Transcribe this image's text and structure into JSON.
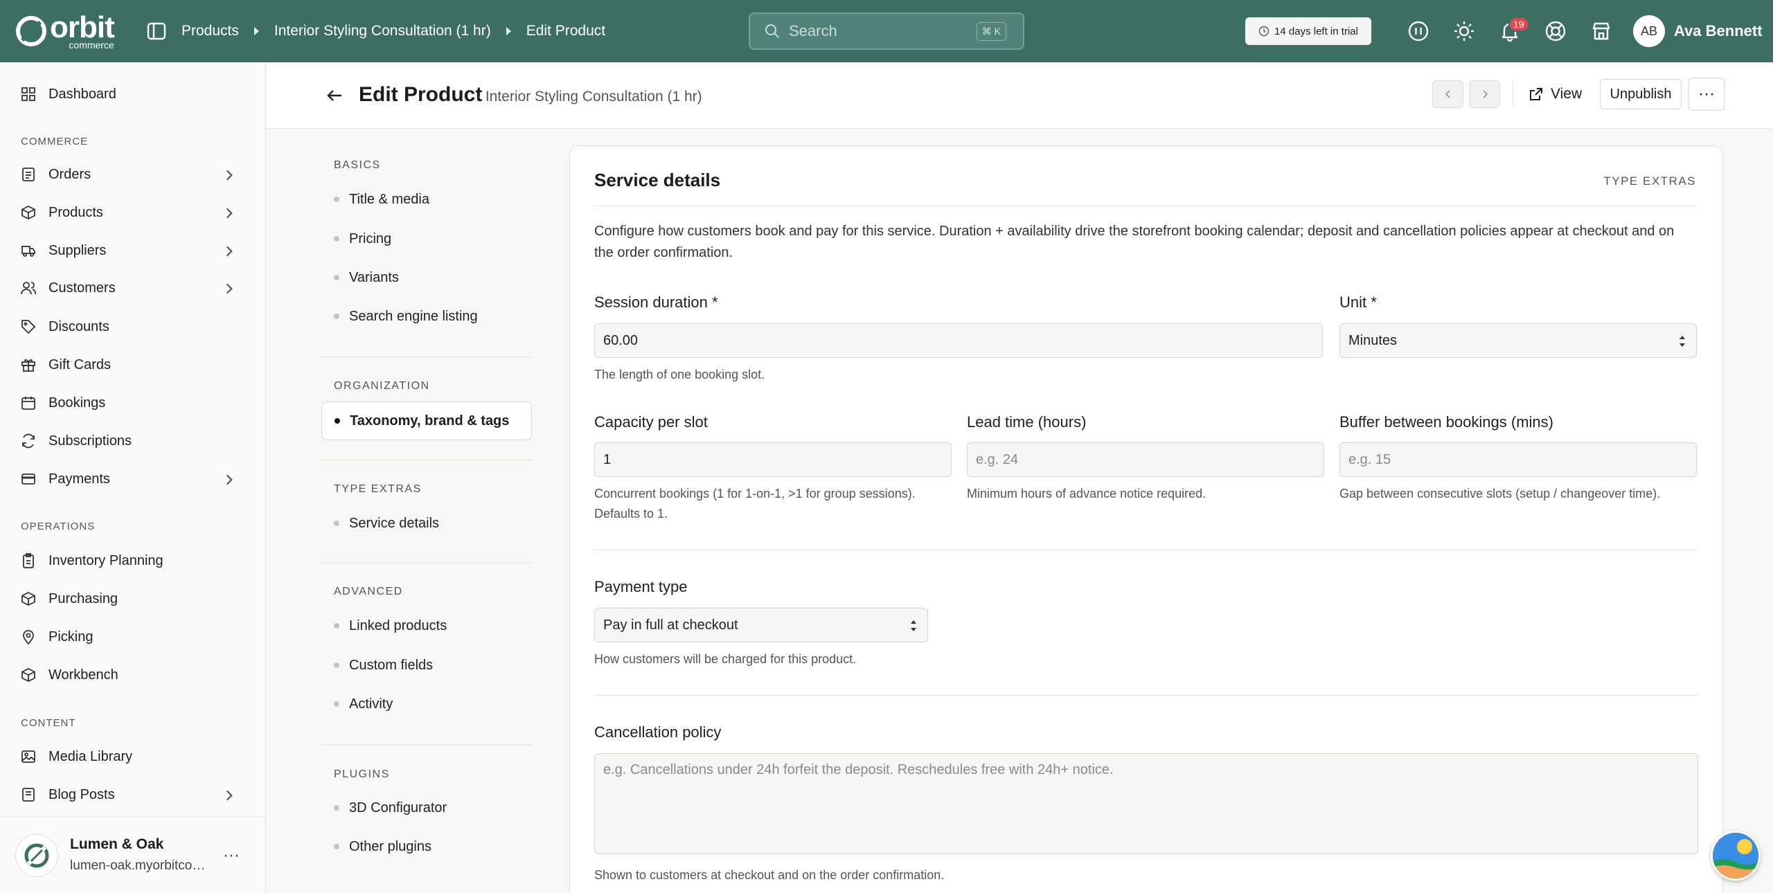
{
  "brand": {
    "name": "orbit",
    "sub": "commerce"
  },
  "breadcrumbs": [
    "Products",
    "Interior Styling Consultation (1 hr)",
    "Edit Product"
  ],
  "search": {
    "placeholder": "Search",
    "shortcut": "⌘ K"
  },
  "trial": "14 days left in trial",
  "notifications_count": "19",
  "user": {
    "initials": "AB",
    "name": "Ava Bennett"
  },
  "sidebar": {
    "dashboard": "Dashboard",
    "commerce_title": "COMMERCE",
    "commerce": [
      "Orders",
      "Products",
      "Suppliers",
      "Customers",
      "Discounts",
      "Gift Cards",
      "Bookings",
      "Subscriptions",
      "Payments"
    ],
    "operations_title": "OPERATIONS",
    "operations": [
      "Inventory Planning",
      "Purchasing",
      "Picking",
      "Workbench"
    ],
    "content_title": "CONTENT",
    "content": [
      "Media Library",
      "Blog Posts"
    ],
    "store": {
      "name": "Lumen & Oak",
      "url": "lumen-oak.myorbitcommerce.com"
    }
  },
  "header": {
    "title": "Edit Product",
    "subtitle": "· Interior Styling Consultation (1 hr)",
    "view": "View",
    "unpublish": "Unpublish",
    "more": "···"
  },
  "section_nav": {
    "basics_title": "BASICS",
    "basics": [
      "Title & media",
      "Pricing",
      "Variants",
      "Search engine listing"
    ],
    "organization_title": "ORGANIZATION",
    "organization_active": "Taxonomy, brand & tags",
    "type_extras_title": "TYPE EXTRAS",
    "type_extras": [
      "Service details"
    ],
    "advanced_title": "ADVANCED",
    "advanced": [
      "Linked products",
      "Custom fields",
      "Activity"
    ],
    "plugins_title": "PLUGINS",
    "plugins": [
      "3D Configurator",
      "Other plugins"
    ]
  },
  "card": {
    "title": "Service details",
    "tag": "TYPE EXTRAS",
    "description": "Configure how customers book and pay for this service. Duration + availability drive the storefront booking calendar; deposit and cancellation policies appear at checkout and on the order confirmation.",
    "duration": {
      "label": "Session duration *",
      "value": "60.00",
      "help": "The length of one booking slot."
    },
    "unit": {
      "label": "Unit *",
      "value": "Minutes"
    },
    "capacity": {
      "label": "Capacity per slot",
      "value": "1",
      "help": "Concurrent bookings (1 for 1-on-1, >1 for group sessions). Defaults to 1."
    },
    "lead_time": {
      "label": "Lead time (hours)",
      "placeholder": "e.g. 24",
      "help": "Minimum hours of advance notice required."
    },
    "buffer": {
      "label": "Buffer between bookings (mins)",
      "placeholder": "e.g. 15",
      "help": "Gap between consecutive slots (setup / changeover time)."
    },
    "payment": {
      "label": "Payment type",
      "value": "Pay in full at checkout",
      "help": "How customers will be charged for this product."
    },
    "cancellation": {
      "label": "Cancellation policy",
      "placeholder": "e.g. Cancellations under 24h forfeit the deposit. Reschedules free with 24h+ notice.",
      "help": "Shown to customers at checkout and on the order confirmation."
    }
  },
  "colors": {
    "topbar": "#3c6e64",
    "badge": "#e5484d"
  }
}
